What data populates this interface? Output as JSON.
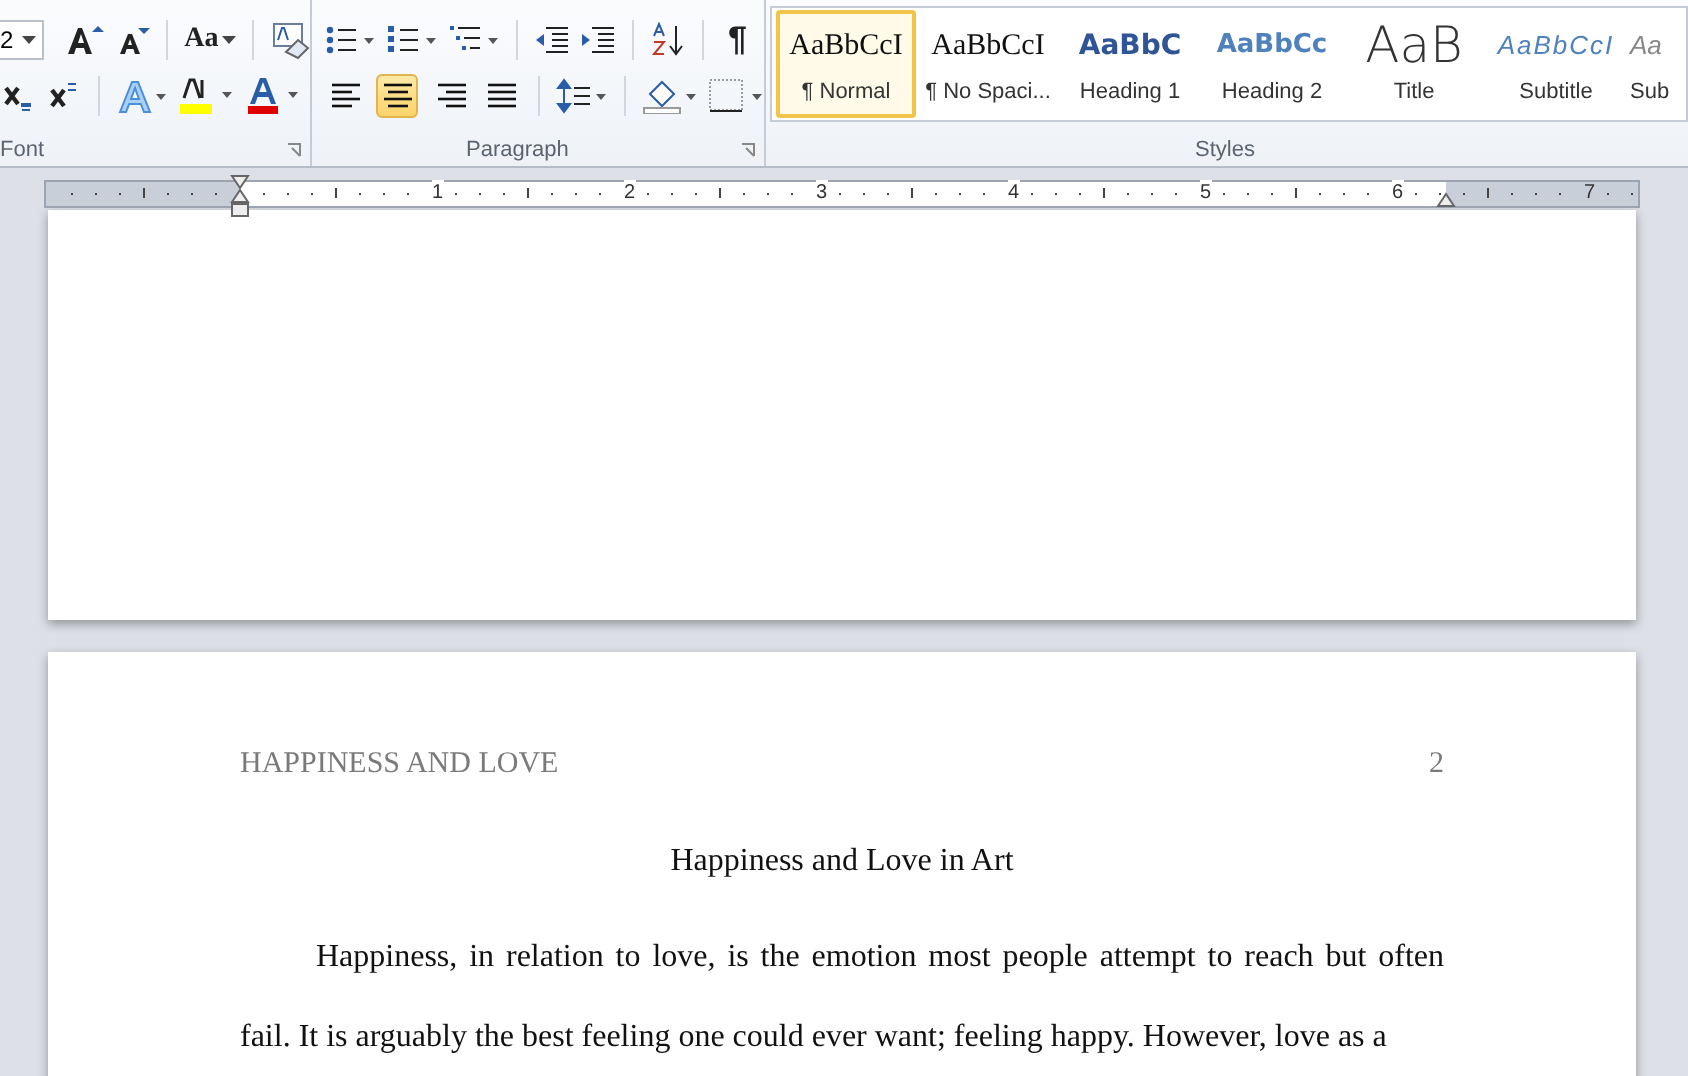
{
  "ribbon": {
    "font": {
      "size": "2",
      "change_case": "Aa",
      "label": "Font"
    },
    "paragraph": {
      "show_marks": "¶",
      "label": "Paragraph",
      "alignments": [
        {
          "kind": "left",
          "selected": false
        },
        {
          "kind": "center",
          "selected": true
        },
        {
          "kind": "right",
          "selected": false
        },
        {
          "kind": "justify",
          "selected": false
        }
      ]
    },
    "styles": {
      "label": "Styles",
      "items": [
        {
          "kind": "normal",
          "preview": "AaBbCcI",
          "label": "¶ Normal",
          "selected": true
        },
        {
          "kind": "normal",
          "preview": "AaBbCcI",
          "label": "¶ No Spaci...",
          "selected": false
        },
        {
          "kind": "heading1",
          "preview": "AaBbC",
          "label": "Heading 1",
          "selected": false
        },
        {
          "kind": "heading2",
          "preview": "AaBbCc",
          "label": "Heading 2",
          "selected": false
        },
        {
          "kind": "title",
          "preview": "AaB",
          "label": "Title",
          "selected": false
        },
        {
          "kind": "subtitle",
          "preview": "AaBbCcI",
          "label": "Subtitle",
          "selected": false
        },
        {
          "kind": "subtle",
          "preview": "Aa",
          "label": "Sub",
          "selected": false
        }
      ]
    }
  },
  "ruler": {
    "numbers": [
      "1",
      "2",
      "3",
      "4",
      "5",
      "6",
      "7"
    ]
  },
  "page": {
    "header": "HAPPINESS AND LOVE",
    "page_number": "2",
    "title": "Happiness and Love in Art",
    "paragraph": "Happiness, in relation to love, is the emotion most people attempt to reach but often fail. It is arguably the best feeling one could ever want; feeling happy. However, love as a"
  }
}
